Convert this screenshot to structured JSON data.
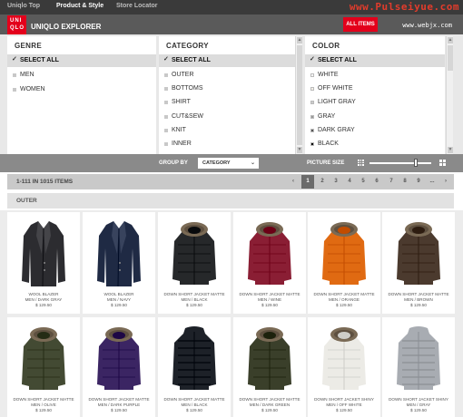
{
  "topnav": {
    "links": [
      "Uniqlo Top",
      "Product & Style",
      "Store Locator"
    ]
  },
  "watermark": {
    "main": "www.Pulseiyue.com",
    "sub": "www.webjx.com"
  },
  "header": {
    "logo_top": "UNI",
    "logo_bottom": "QLO",
    "title": "UNIQLO EXPLORER",
    "all_items": "ALL ITEMS"
  },
  "filters": {
    "genre": {
      "title": "GENRE",
      "options": [
        "SELECT ALL",
        "MEN",
        "WOMEN"
      ]
    },
    "category": {
      "title": "CATEGORY",
      "options": [
        "SELECT ALL",
        "OUTER",
        "BOTTOMS",
        "SHIRT",
        "CUT&SEW",
        "KNIT",
        "INNER"
      ]
    },
    "color": {
      "title": "COLOR",
      "options": [
        "SELECT ALL",
        "WHITE",
        "OFF WHITE",
        "LIGHT GRAY",
        "GRAY",
        "DARK GRAY",
        "BLACK"
      ],
      "swatches": [
        "#ffffff",
        "#ffffff",
        "#f4f1e8",
        "#cccccc",
        "#9a9a9a",
        "#555555",
        "#000000"
      ]
    }
  },
  "toolbar": {
    "group_by_label": "GROUP BY",
    "group_by_value": "CATEGORY",
    "picture_size_label": "PICTURE SIZE",
    "picture_size_level": 0.75
  },
  "pager": {
    "count": "1-111 IN 1015 ITEMS",
    "prev": "‹",
    "pages": [
      "1",
      "2",
      "3",
      "4",
      "5",
      "6",
      "7",
      "8",
      "9",
      "..."
    ],
    "next": "›",
    "current": "1"
  },
  "section": {
    "title": "OUTER"
  },
  "products": [
    {
      "name": [
        "WOOL BLAZER",
        "MEN / DARK GRAY"
      ],
      "price": "$ 129.50",
      "color": "#2c2c30",
      "type": "blazer"
    },
    {
      "name": [
        "WOOL BLAZER",
        "MEN / NAVY"
      ],
      "price": "$ 129.50",
      "color": "#1f2a44",
      "type": "blazer"
    },
    {
      "name": [
        "DOWN SHORT JACKET MATTE",
        "MEN / BLACK"
      ],
      "price": "$ 129.50",
      "color": "#26282a",
      "type": "parka"
    },
    {
      "name": [
        "DOWN SHORT JACKET MATTE",
        "MEN / WINE"
      ],
      "price": "$ 129.50",
      "color": "#8a1e34",
      "type": "parka"
    },
    {
      "name": [
        "DOWN SHORT JACKET MATTE",
        "MEN / ORANGE"
      ],
      "price": "$ 129.50",
      "color": "#e06a12",
      "type": "parka"
    },
    {
      "name": [
        "DOWN SHORT JACKET MATTE",
        "MEN / BROWN"
      ],
      "price": "$ 129.50",
      "color": "#4b3a2e",
      "type": "parka"
    },
    {
      "name": [
        "DOWN SHORT JACKET MATTE",
        "MEN / OLIVE"
      ],
      "price": "$ 129.50",
      "color": "#434a33",
      "type": "parka"
    },
    {
      "name": [
        "DOWN SHORT JACKET MATTE",
        "MEN / DARK PURPLE"
      ],
      "price": "$ 129.50",
      "color": "#3b2563",
      "type": "parka"
    },
    {
      "name": [
        "DOWN SHORT JACKET MATTE",
        "MEN / BLACK"
      ],
      "price": "$ 129.50",
      "color": "#1d2128",
      "type": "puffer"
    },
    {
      "name": [
        "DOWN SHORT JACKET MATTE",
        "MEN / DARK GREEN"
      ],
      "price": "$ 129.50",
      "color": "#3a3f2a",
      "type": "parka"
    },
    {
      "name": [
        "DOWN SHORT JACKET SHINY",
        "MEN / OFF WHITE"
      ],
      "price": "$ 129.50",
      "color": "#ecebe6",
      "type": "parka"
    },
    {
      "name": [
        "DOWN SHORT JACKET SHINY",
        "MEN / GRAY"
      ],
      "price": "$ 129.50",
      "color": "#a8acb2",
      "type": "puffer"
    }
  ]
}
